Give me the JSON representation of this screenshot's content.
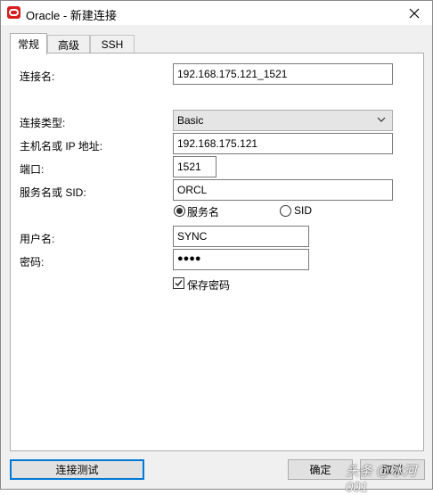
{
  "window": {
    "title": "Oracle - 新建连接"
  },
  "tabs": [
    {
      "label": "常规"
    },
    {
      "label": "高级"
    },
    {
      "label": "SSH"
    }
  ],
  "form": {
    "connection_name": {
      "label": "连接名:",
      "value": "192.168.175.121_1521"
    },
    "connection_type": {
      "label": "连接类型:",
      "value": "Basic"
    },
    "host": {
      "label": "主机名或 IP 地址:",
      "value": "192.168.175.121"
    },
    "port": {
      "label": "端口:",
      "value": "1521"
    },
    "service": {
      "label": "服务名或 SID:",
      "value": "ORCL"
    },
    "service_type": {
      "option_service": "服务名",
      "option_sid": "SID",
      "selected": "服务名"
    },
    "username": {
      "label": "用户名:",
      "value": "SYNC"
    },
    "password": {
      "label": "密码:",
      "value": "●●●●"
    },
    "save_password": {
      "label": "保存密码",
      "checked": true
    }
  },
  "buttons": {
    "test": "连接测试",
    "ok": "确定",
    "cancel": "取消"
  },
  "watermark": "头条 @冰河001"
}
